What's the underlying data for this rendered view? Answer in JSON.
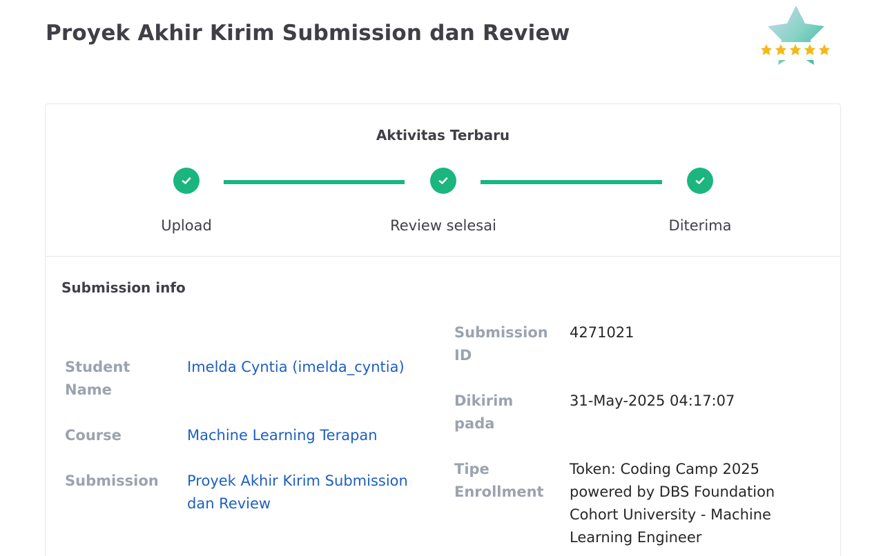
{
  "page": {
    "title": "Proyek Akhir Kirim Submission dan Review"
  },
  "badge": {
    "icon": "star-rating-badge-icon",
    "rating_stars": 5,
    "colors": {
      "star": "#f5b819",
      "glass": "#7fd1c7"
    }
  },
  "activity": {
    "title": "Aktivitas Terbaru",
    "steps": [
      {
        "label": "Upload",
        "status": "done"
      },
      {
        "label": "Review selesai",
        "status": "done"
      },
      {
        "label": "Diterima",
        "status": "done"
      }
    ],
    "accent_color": "#1bb57f"
  },
  "submission_info": {
    "title": "Submission info",
    "student_name_label": "Student Name",
    "student_name_value": "Imelda Cyntia (imelda_cyntia)",
    "course_label": "Course",
    "course_value": "Machine Learning Terapan",
    "submission_label": "Submission",
    "submission_value": "Proyek Akhir Kirim Submission dan Review",
    "submission_id_label": "Submission ID",
    "submission_id_value": "4271021",
    "sent_at_label": "Dikirim pada",
    "sent_at_value": "31-May-2025 04:17:07",
    "enrollment_type_label": "Tipe Enrollment",
    "enrollment_type_value": "Token: Coding Camp 2025 powered by DBS Foundation Cohort University - Machine Learning Engineer",
    "link_color": "#1d5fc2"
  }
}
